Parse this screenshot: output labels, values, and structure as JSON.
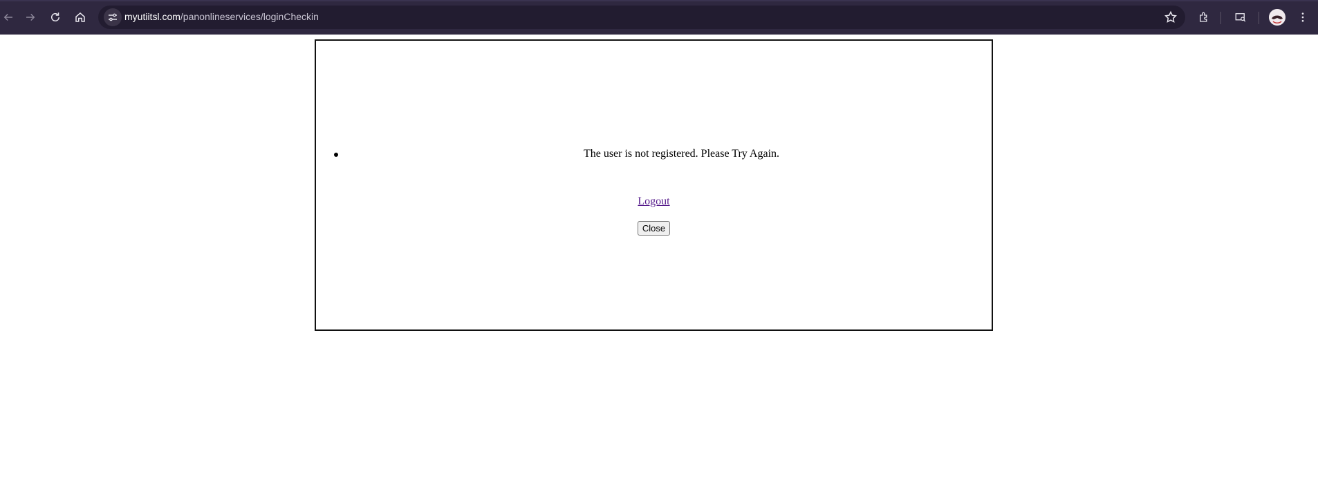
{
  "browser": {
    "url_domain": "myutiitsl.com",
    "url_path": "/panonlineservices/loginCheckin",
    "icons": [
      "back-icon",
      "forward-icon",
      "reload-icon",
      "home-icon",
      "site-info-icon",
      "bookmark-star-icon",
      "extensions-icon",
      "reading-mode-icon",
      "profile-avatar",
      "more-menu-icon"
    ]
  },
  "page": {
    "error_message": "The user is not registered. Please Try Again.",
    "logout_link": "Logout",
    "close_button": "Close"
  },
  "colors": {
    "toolbar_bg": "#2f2840",
    "omnibox_bg": "#221c30",
    "visited_link": "#551a8b"
  }
}
